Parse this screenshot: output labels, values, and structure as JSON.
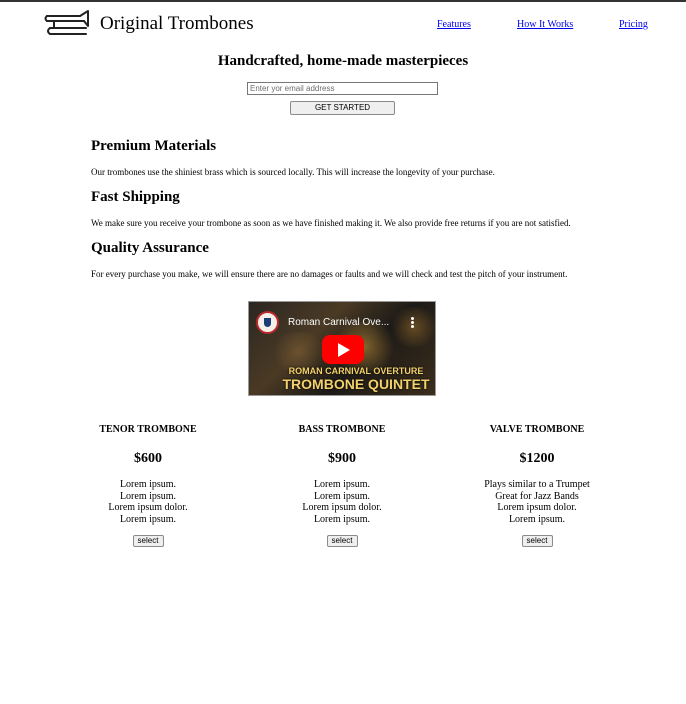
{
  "header": {
    "logo_icon": "trombone-icon",
    "logo_text": "Original Trombones",
    "nav": [
      {
        "label": "Features"
      },
      {
        "label": "How It Works"
      },
      {
        "label": "Pricing"
      }
    ]
  },
  "hero": {
    "title": "Handcrafted, home-made masterpieces",
    "email_placeholder": "Enter yor email address",
    "submit_label": "GET STARTED"
  },
  "features": [
    {
      "title": "Premium Materials",
      "text": "Our trombones use the shiniest brass which is sourced locally. This will increase the longevity of your purchase."
    },
    {
      "title": "Fast Shipping",
      "text": "We make sure you receive your trombone as soon as we have finished making it. We also provide free returns if you are not satisfied."
    },
    {
      "title": "Quality Assurance",
      "text": "For every purchase you make, we will ensure there are no damages or faults and we will check and test the pitch of your instrument."
    }
  ],
  "video": {
    "title": "Roman Carnival Ove...",
    "caption_line1": "ROMAN CARNIVAL OVERTURE",
    "caption_line2": "TROMBONE QUINTET",
    "play_icon": "play-icon",
    "menu_icon": "more-vertical-icon",
    "accent_color": "#ff0000"
  },
  "products": [
    {
      "name": "TENOR TROMBONE",
      "price": "$600",
      "features": [
        "Lorem ipsum.",
        "Lorem ipsum.",
        "Lorem ipsum dolor.",
        "Lorem ipsum."
      ],
      "button": "select"
    },
    {
      "name": "BASS TROMBONE",
      "price": "$900",
      "features": [
        "Lorem ipsum.",
        "Lorem ipsum.",
        "Lorem ipsum dolor.",
        "Lorem ipsum."
      ],
      "button": "select"
    },
    {
      "name": "VALVE TROMBONE",
      "price": "$1200",
      "features": [
        "Plays similar to a Trumpet",
        "Great for Jazz Bands",
        "Lorem ipsum dolor.",
        "Lorem ipsum."
      ],
      "button": "select"
    }
  ]
}
